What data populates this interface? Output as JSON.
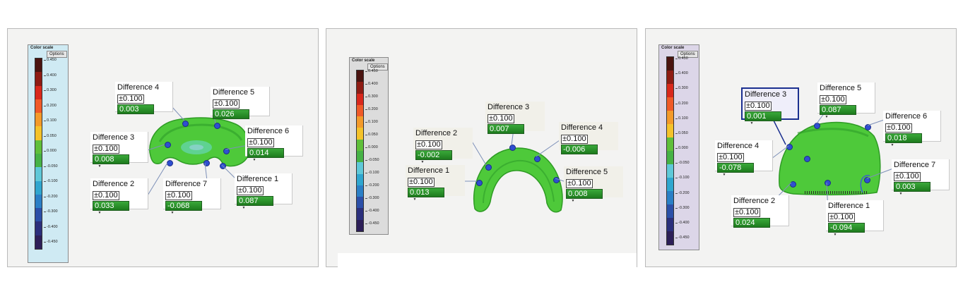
{
  "scale": {
    "title": "Color scale",
    "options_label": "Options",
    "ticks": [
      "0.450",
      "0.400",
      "0.300",
      "0.200",
      "0.100",
      "0.050",
      "0.000",
      "-0.050",
      "-0.100",
      "-0.200",
      "-0.300",
      "-0.400",
      "-0.450"
    ],
    "colors": [
      "#4a1410",
      "#8e1c14",
      "#d8281c",
      "#ef5a28",
      "#f39a2a",
      "#f4c22a",
      "#5fbf3a",
      "#46b246",
      "#5ec8d8",
      "#2fa6cf",
      "#2a7fc6",
      "#2b4fa8",
      "#2b2f7c",
      "#2d1f58"
    ]
  },
  "panels": [
    {
      "callouts": [
        {
          "title": "Difference 4",
          "tol": "±0.100",
          "val": "0.003"
        },
        {
          "title": "Difference 5",
          "tol": "±0.100",
          "val": "0.026"
        },
        {
          "title": "Difference 3",
          "tol": "±0.100",
          "val": "0.008"
        },
        {
          "title": "Difference 6",
          "tol": "±0.100",
          "val": "0.014"
        },
        {
          "title": "Difference 1",
          "tol": "±0.100",
          "val": "0.087"
        },
        {
          "title": "Difference 2",
          "tol": "±0.100",
          "val": "0.033"
        },
        {
          "title": "Difference 7",
          "tol": "±0.100",
          "val": "-0.068"
        }
      ]
    },
    {
      "callouts": [
        {
          "title": "Difference 3",
          "tol": "±0.100",
          "val": "0.007"
        },
        {
          "title": "Difference 2",
          "tol": "±0.100",
          "val": "-0.002"
        },
        {
          "title": "Difference 4",
          "tol": "±0.100",
          "val": "-0.006"
        },
        {
          "title": "Difference 1",
          "tol": "±0.100",
          "val": "0.013"
        },
        {
          "title": "Difference 5",
          "tol": "±0.100",
          "val": "0.008"
        }
      ]
    },
    {
      "callouts": [
        {
          "title": "Difference 3",
          "tol": "±0.100",
          "val": "0.001"
        },
        {
          "title": "Difference 5",
          "tol": "±0.100",
          "val": "0.087"
        },
        {
          "title": "Difference 6",
          "tol": "±0.100",
          "val": "0.018"
        },
        {
          "title": "Difference 4",
          "tol": "±0.100",
          "val": "-0.078"
        },
        {
          "title": "Difference 7",
          "tol": "±0.100",
          "val": "0.003"
        },
        {
          "title": "Difference 2",
          "tol": "±0.100",
          "val": "0.024"
        },
        {
          "title": "Difference 1",
          "tol": "±0.100",
          "val": "-0.094"
        }
      ]
    }
  ]
}
